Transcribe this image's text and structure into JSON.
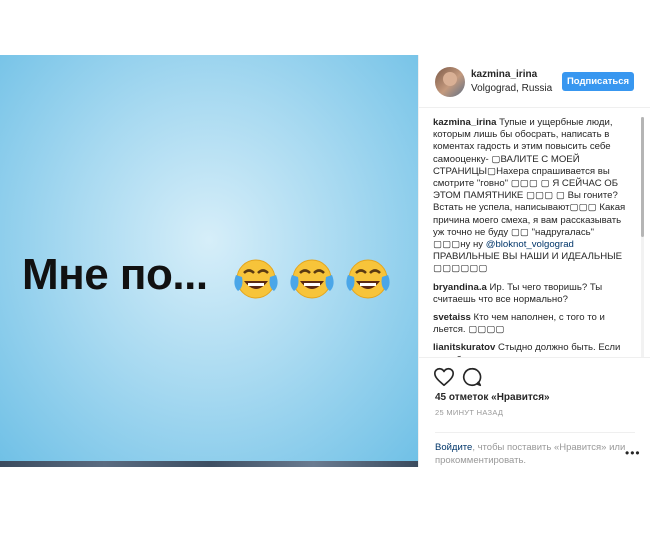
{
  "post": {
    "photo_text": "Мне по...",
    "emoji_names": [
      "tears-of-joy-emoji",
      "tears-of-joy-emoji",
      "tears-of-joy-emoji"
    ]
  },
  "header": {
    "username": "kazmina_irina",
    "location": "Volgograd, Russia",
    "follow_label": "Подписаться"
  },
  "comments": [
    {
      "user": "kazmina_irina",
      "text": " Тупые и ущербные люди, которым лишь бы обосрать, написать в коментах гадость и этим повысить себе самооценку- ▢ВАЛИТЕ С МОЕЙ СТРАНИЦЫ▢Нахера спрашивается вы смотрите \"говно\" ▢▢▢ ▢ Я СЕЙЧАС ОБ ЭТОМ ПАМЯТНИКЕ ▢▢▢ ▢ Вы гоните? Встать не успела, написывают▢▢▢ Какая причина моего смеха, я вам рассказывать уж точно не буду ▢▢ \"надругалась\" ▢▢▢ну ну ",
      "mention": "@bloknot_volgograd",
      "tail": " ПРАВИЛЬНЫЕ ВЫ НАШИ И ИДЕАЛЬНЫЕ ▢▢▢▢▢▢"
    },
    {
      "user": "bryandina.a",
      "text": " Ир. Ты чего творишь? Ты считаешь что все нормально?"
    },
    {
      "user": "svetaiss",
      "text": " Кто чем наполнен, с того то и льется. ▢▢▢▢"
    },
    {
      "user": "lianitskuratov",
      "text": " Стыдно должно быть. Если не тебе, то твоим родителям"
    }
  ],
  "actions": {
    "like_icon": "heart-icon",
    "comment_icon": "comment-icon",
    "likes_text": "45 отметок «Нравится»",
    "timestamp": "25 МИНУТ НАЗАД",
    "login_link": "Войдите",
    "login_text": ", чтобы поставить «Нравится» или прокомментировать.",
    "more_label": "•••"
  }
}
